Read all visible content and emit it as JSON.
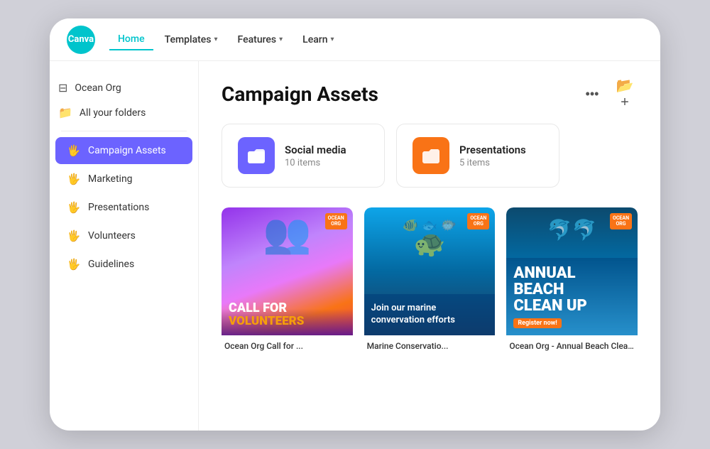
{
  "logo": {
    "text": "Canva"
  },
  "nav": {
    "home_label": "Home",
    "templates_label": "Templates",
    "features_label": "Features",
    "learn_label": "Learn"
  },
  "sidebar": {
    "org_name": "Ocean Org",
    "all_folders_label": "All your folders",
    "items": [
      {
        "id": "campaign-assets",
        "label": "Campaign Assets",
        "active": true
      },
      {
        "id": "marketing",
        "label": "Marketing",
        "active": false
      },
      {
        "id": "presentations",
        "label": "Presentations",
        "active": false
      },
      {
        "id": "volunteers",
        "label": "Volunteers",
        "active": false
      },
      {
        "id": "guidelines",
        "label": "Guidelines",
        "active": false
      }
    ]
  },
  "content": {
    "title": "Campaign Assets",
    "folders": [
      {
        "id": "social-media",
        "name": "Social media",
        "count": "10 items",
        "color": "purple"
      },
      {
        "id": "presentations",
        "name": "Presentations",
        "count": "5 items",
        "color": "orange"
      }
    ],
    "designs": [
      {
        "id": "call-for-volunteers",
        "label": "Ocean Org Call for ...",
        "title_line1": "CALL FOR",
        "title_line2": "VOLUNTEERS",
        "logo_line1": "OCEAN",
        "logo_line2": "ORG"
      },
      {
        "id": "marine-conservation",
        "label": "Marine Conservatio...",
        "body": "Join our marine convervation efforts",
        "logo_line1": "OCEAN",
        "logo_line2": "ORG"
      },
      {
        "id": "beach-cleanup",
        "label": "Ocean Org - Annual Beach Clean up",
        "title_line1": "ANNUAL",
        "title_line2": "BEACH",
        "title_line3": "CLEAN UP",
        "badge": "Register now!",
        "logo_line1": "OCEAN",
        "logo_line2": "ORG"
      }
    ]
  },
  "icons": {
    "more_options": "···",
    "new_folder": "⊞",
    "chevron_down": "▾"
  }
}
